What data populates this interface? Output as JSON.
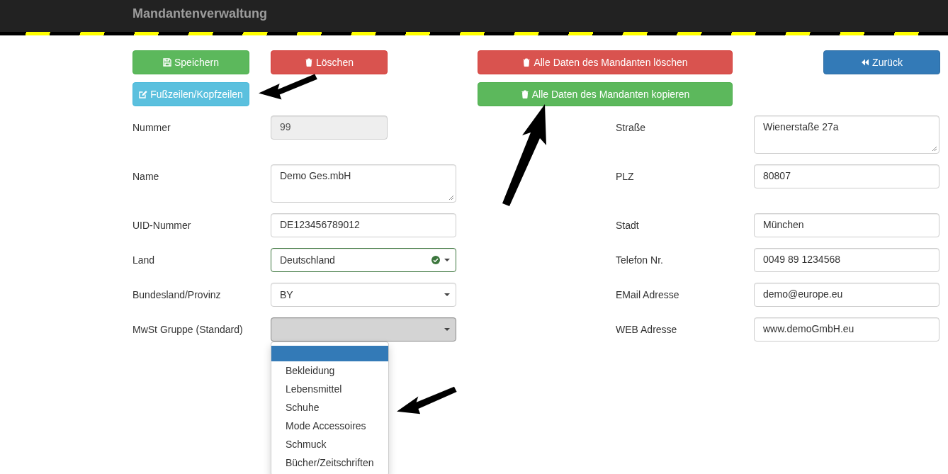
{
  "header": {
    "title": "Mandantenverwaltung"
  },
  "buttons": [
    {
      "label": "Speichern",
      "kind": "success"
    },
    {
      "label": "Löschen",
      "kind": "danger"
    },
    {
      "label": "Alle Daten des Mandanten löschen",
      "kind": "danger"
    },
    {
      "label": "Zurück",
      "kind": "primary"
    },
    {
      "label": "Fußzeilen/Kopfzeilen",
      "kind": "info"
    },
    {
      "label": "Alle Daten des Mandanten kopieren",
      "kind": "success"
    }
  ],
  "form": {
    "rows": [
      {
        "left": {
          "label": "Nummer",
          "kind": "text",
          "value": "99",
          "disabled": true
        },
        "right": {
          "label": "Straße",
          "kind": "textarea",
          "value": "Wienerstaße 27a",
          "disabled": false
        }
      },
      {
        "left": {
          "label": "Name",
          "kind": "textarea",
          "value": "Demo Ges.mbH",
          "disabled": false
        },
        "right": {
          "label": "PLZ",
          "kind": "text",
          "value": "80807",
          "disabled": false
        }
      },
      {
        "left": {
          "label": "UID-Nummer",
          "kind": "text",
          "value": "DE123456789012",
          "disabled": false
        },
        "right": {
          "label": "Stadt",
          "kind": "text",
          "value": "München",
          "disabled": false
        }
      },
      {
        "left": {
          "label": "Land",
          "kind": "select",
          "value": "Deutschland",
          "valid": true,
          "focused": false
        },
        "right": {
          "label": "Telefon Nr.",
          "kind": "text",
          "value": "0049 89 1234568",
          "disabled": false
        }
      },
      {
        "left": {
          "label": "Bundesland/Provinz",
          "kind": "select",
          "value": "BY",
          "valid": false,
          "focused": false
        },
        "right": {
          "label": "EMail Adresse",
          "kind": "text",
          "value": "demo@europe.eu",
          "disabled": false
        }
      },
      {
        "left": {
          "label": "MwSt Gruppe (Standard)",
          "kind": "select",
          "valid": false,
          "focused": true
        },
        "right": {
          "label": "WEB Adresse",
          "kind": "text",
          "value": "www.demoGmbH.eu",
          "disabled": false
        }
      }
    ]
  },
  "dropdown_options": [
    {
      "selected": true
    },
    {
      "label": "Bekleidung",
      "selected": false
    },
    {
      "label": "Lebensmittel",
      "selected": false
    },
    {
      "label": "Schuhe",
      "selected": false
    },
    {
      "label": "Mode Accessoires",
      "selected": false
    },
    {
      "label": "Schmuck",
      "selected": false
    },
    {
      "label": "Bücher/Zeitschriften",
      "selected": false
    }
  ]
}
